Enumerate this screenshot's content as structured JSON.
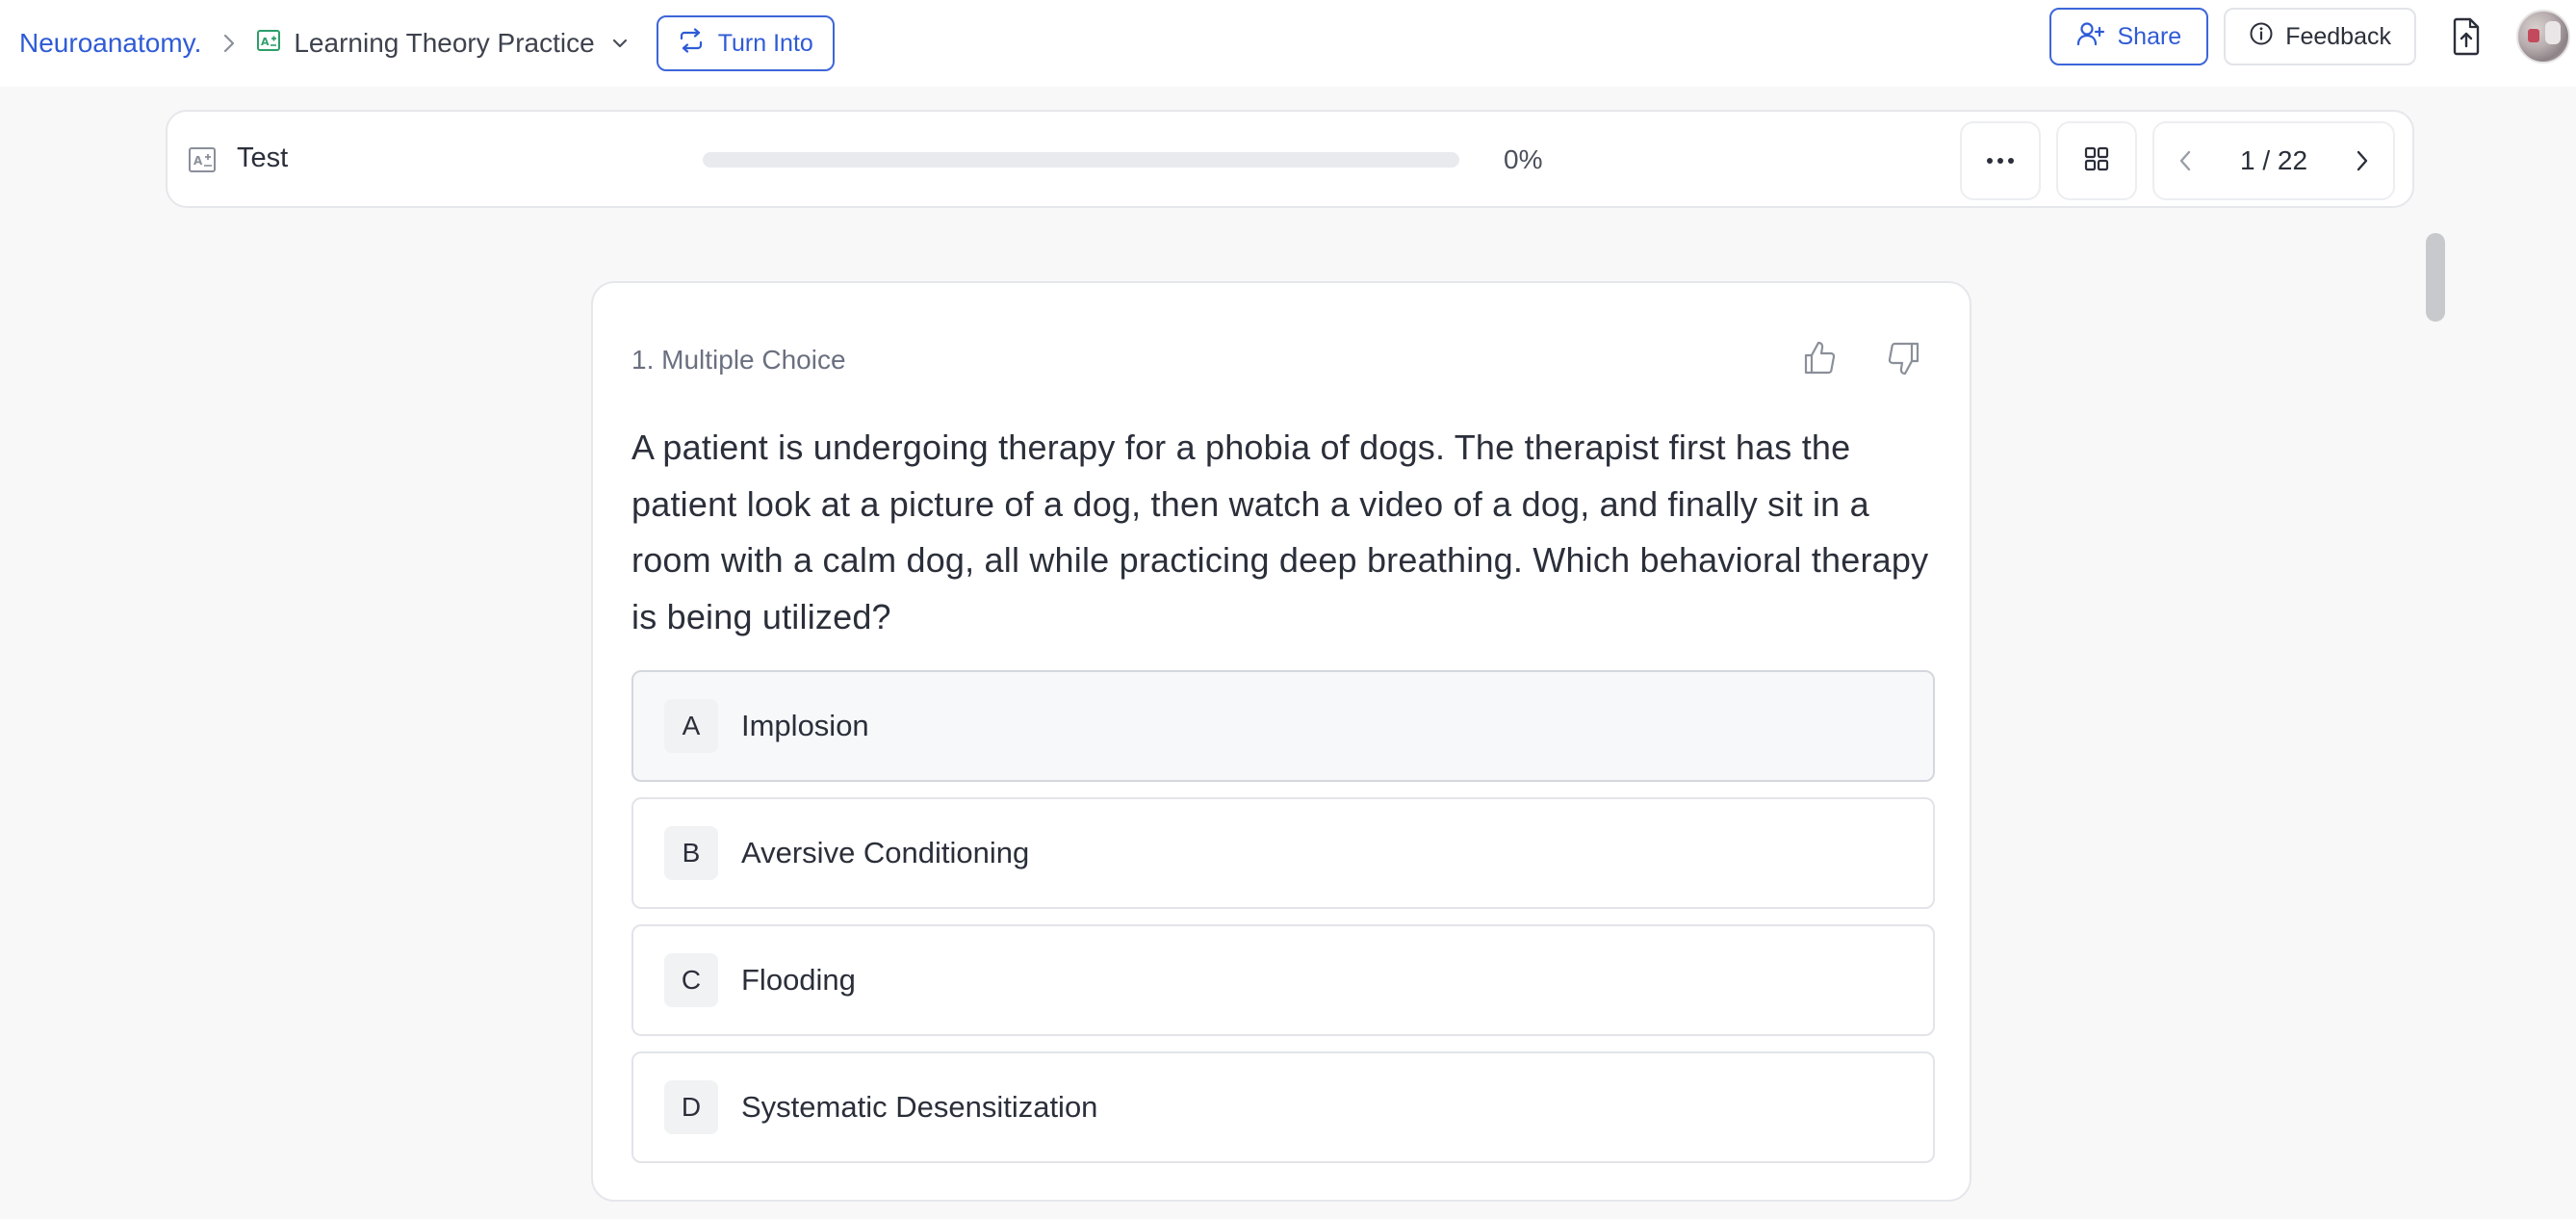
{
  "breadcrumb": {
    "root": "Neuroanatomy.",
    "document": "Learning Theory Practice"
  },
  "toolbar": {
    "turn_into_label": "Turn Into",
    "share_label": "Share",
    "feedback_label": "Feedback"
  },
  "test": {
    "title": "Test",
    "progress_fraction": 0,
    "progress_text": "0%",
    "pager_text": "1 / 22"
  },
  "question": {
    "type_label": "1. Multiple Choice",
    "text": "A patient is undergoing therapy for a phobia of dogs. The therapist first has the patient look at a picture of a dog, then watch a video of a dog, and finally sit in a room with a calm dog, all while practicing deep breathing. Which behavioral therapy is being utilized?",
    "options": [
      {
        "letter": "A",
        "label": "Implosion"
      },
      {
        "letter": "B",
        "label": "Aversive Conditioning"
      },
      {
        "letter": "C",
        "label": "Flooding"
      },
      {
        "letter": "D",
        "label": "Systematic Desensitization"
      }
    ]
  },
  "colors": {
    "accent": "#2f5bd6",
    "doc_icon_green": "#2e9e6a",
    "page_bg": "#f8f8f9"
  },
  "icons": [
    "chevron-right-icon",
    "flashcard-doc-icon",
    "chevron-down-icon",
    "convert-icon",
    "add-user-icon",
    "info-icon",
    "file-export-icon",
    "test-doc-icon",
    "more-dots-icon",
    "grid-icon",
    "chevron-left-icon",
    "thumbs-up-icon",
    "thumbs-down-icon"
  ]
}
